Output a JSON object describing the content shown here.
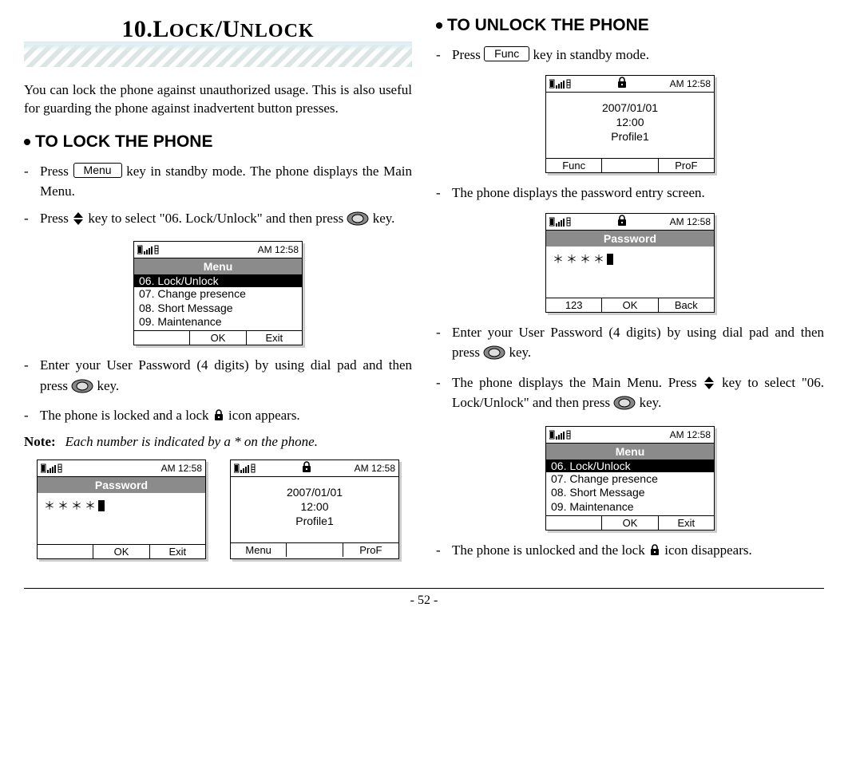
{
  "chapter": {
    "number": "10.",
    "title_big": "L",
    "title_rest1": "OCK",
    "slash": "/",
    "title_big2": "U",
    "title_rest2": "NLOCK"
  },
  "intro": "You can lock the phone against unauthorized usage. This is also useful for guarding the phone against inadvertent button presses.",
  "lock": {
    "heading": "TO LOCK THE PHONE",
    "step1a": "Press ",
    "step1_key": "Menu",
    "step1b": " key in standby mode. The phone displays the Main Menu.",
    "step2a": "Press ",
    "step2b": " key to select \"06. Lock/Unlock\" and then press ",
    "step2c": " key.",
    "step3a": "Enter your User Password (4 digits) by using dial pad and then press ",
    "step3b": " key.",
    "step4a": "The phone is locked and a lock ",
    "step4b": " icon appears."
  },
  "note": {
    "label": "Note:",
    "text": "Each number is indicated by a * on the phone."
  },
  "unlock": {
    "heading": "TO UNLOCK THE PHONE",
    "step1a": "Press ",
    "step1_key": "Func",
    "step1b": " key in standby mode.",
    "step2": "The phone displays the password entry screen.",
    "step3a": "Enter your User Password (4 digits) by using dial pad and then press ",
    "step3b": " key.",
    "step4a": "The phone displays the Main Menu. Press ",
    "step4b": " key to select \"06. Lock/Unlock\" and then press ",
    "step4c": " key.",
    "step5a": "The phone is unlocked and the lock ",
    "step5b": "  icon disappears."
  },
  "screens": {
    "time": "AM 12:58",
    "standby": {
      "date": "2007/01/01",
      "clock": "12:00",
      "profile": "Profile1",
      "left": "Menu",
      "right": "ProF",
      "left_locked": "Func"
    },
    "menu": {
      "title": "Menu",
      "sel": "06. Lock/Unlock",
      "i2": "07. Change presence",
      "i3": "08. Short Message",
      "i4": "09. Maintenance",
      "ok": "OK",
      "exit": "Exit"
    },
    "password": {
      "title": "Password",
      "stars": "＊＊＊＊",
      "ok": "OK",
      "exit": "Exit",
      "back": "Back",
      "mode": "123"
    }
  },
  "footer": {
    "page": "- 52 -"
  }
}
